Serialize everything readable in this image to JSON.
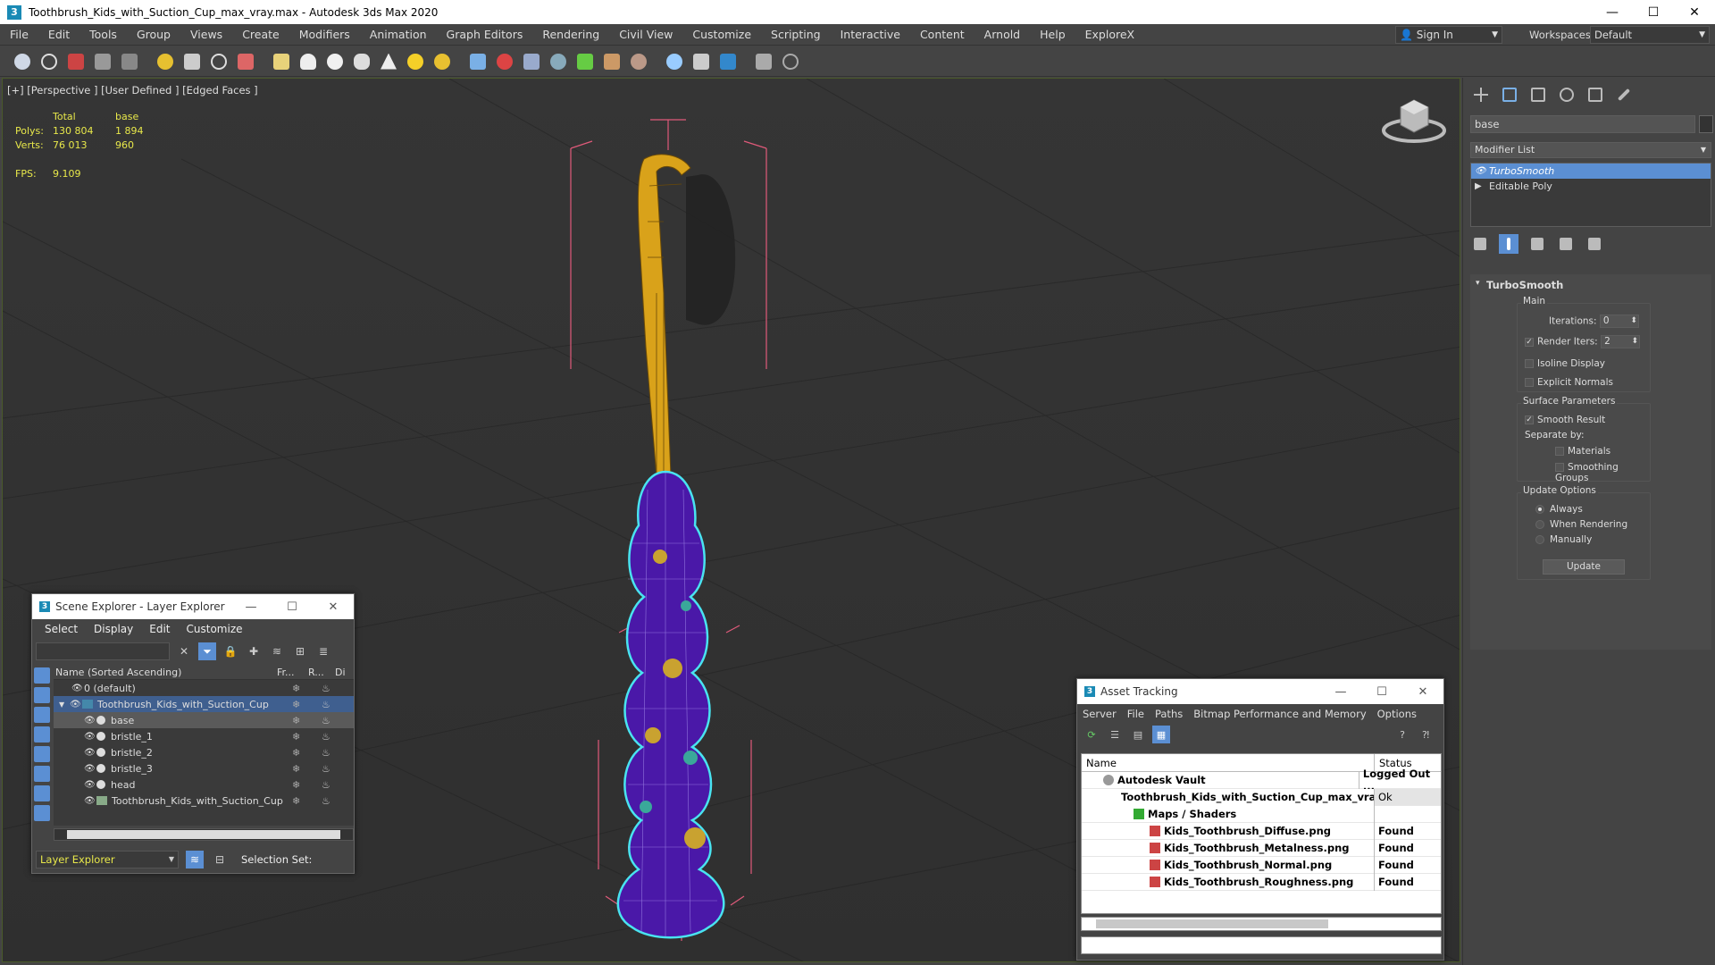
{
  "window": {
    "title": "Toothbrush_Kids_with_Suction_Cup_max_vray.max - Autodesk 3ds Max 2020",
    "minimize": "—",
    "maximize": "☐",
    "close": "✕"
  },
  "menubar": {
    "items": [
      "File",
      "Edit",
      "Tools",
      "Group",
      "Views",
      "Create",
      "Modifiers",
      "Animation",
      "Graph Editors",
      "Rendering",
      "Civil View",
      "Customize",
      "Scripting",
      "Interactive",
      "Content",
      "Arnold",
      "Help",
      "ExploreX"
    ],
    "sign_in": "Sign In",
    "workspaces_label": "Workspaces:",
    "workspace_value": "Default"
  },
  "viewport": {
    "label": "[+] [Perspective ] [User Defined ] [Edged Faces ]",
    "stats": {
      "col_total": "Total",
      "col_base": "base",
      "polys_label": "Polys:",
      "polys_total": "130 804",
      "polys_base": "1 894",
      "verts_label": "Verts:",
      "verts_total": "76 013",
      "verts_base": "960",
      "fps_label": "FPS:",
      "fps_value": "9.109"
    }
  },
  "command_panel": {
    "object_name": "base",
    "modifier_list": "Modifier List",
    "stack": [
      "TurboSmooth",
      "Editable Poly"
    ],
    "rollout_title": "TurboSmooth",
    "main_label": "Main",
    "iterations_label": "Iterations:",
    "iterations_value": "0",
    "render_iters_label": "Render Iters:",
    "render_iters_value": "2",
    "isoline_label": "Isoline Display",
    "explicit_normals_label": "Explicit Normals",
    "surface_params_label": "Surface Parameters",
    "smooth_result_label": "Smooth Result",
    "separate_by_label": "Separate by:",
    "materials_label": "Materials",
    "smoothing_groups_label": "Smoothing Groups",
    "update_options_label": "Update Options",
    "always_label": "Always",
    "when_rendering_label": "When Rendering",
    "manually_label": "Manually",
    "update_button": "Update"
  },
  "scene_explorer": {
    "title": "Scene Explorer - Layer Explorer",
    "menu": [
      "Select",
      "Display",
      "Edit",
      "Customize"
    ],
    "col_name": "Name (Sorted Ascending)",
    "col_frozen": "Fr...",
    "col_render": "R...",
    "col_display": "Di",
    "rows": [
      "0 (default)",
      "Toothbrush_Kids_with_Suction_Cup",
      "base",
      "bristle_1",
      "bristle_2",
      "bristle_3",
      "head",
      "Toothbrush_Kids_with_Suction_Cup"
    ],
    "mode": "Layer Explorer",
    "selection_set": "Selection Set:"
  },
  "asset_tracking": {
    "title": "Asset Tracking",
    "menu": [
      "Server",
      "File",
      "Paths",
      "Bitmap Performance and Memory",
      "Options"
    ],
    "col_name": "Name",
    "col_status": "Status",
    "rows": [
      {
        "name": "Autodesk Vault",
        "status": "Logged Out ..."
      },
      {
        "name": "Toothbrush_Kids_with_Suction_Cup_max_vray.max",
        "status": "Ok"
      },
      {
        "name": "Maps / Shaders",
        "status": ""
      },
      {
        "name": "Kids_Toothbrush_Diffuse.png",
        "status": "Found"
      },
      {
        "name": "Kids_Toothbrush_Metalness.png",
        "status": "Found"
      },
      {
        "name": "Kids_Toothbrush_Normal.png",
        "status": "Found"
      },
      {
        "name": "Kids_Toothbrush_Roughness.png",
        "status": "Found"
      }
    ]
  },
  "colors": {
    "accent": "#5b8fd3",
    "stats_text": "#e8e84a",
    "handle_yellow": "#d9a21a",
    "body_purple": "#4a18a8",
    "selection_cyan": "#49e3f0"
  }
}
